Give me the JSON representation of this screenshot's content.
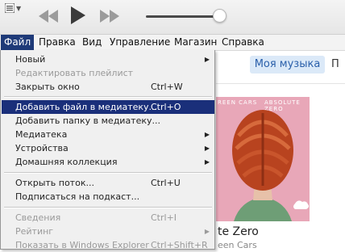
{
  "menubar": {
    "items": [
      {
        "label": "Файл"
      },
      {
        "label": "Правка"
      },
      {
        "label": "Вид"
      },
      {
        "label": "Управление"
      },
      {
        "label": "Магазин"
      },
      {
        "label": "Справка"
      }
    ]
  },
  "content": {
    "tab_active": "Моя музыка",
    "tab_next": "П",
    "album_title": "te Zero",
    "album_artist": "een Cars",
    "album_cover_text_left": "REEN CARS",
    "album_cover_text_right": "ABSOLUTE ZERO"
  },
  "file_menu": {
    "items": [
      {
        "label": "Новый",
        "shortcut": "",
        "submenu": true,
        "disabled": false
      },
      {
        "label": "Редактировать плейлист",
        "shortcut": "",
        "submenu": false,
        "disabled": true
      },
      {
        "label": "Закрыть окно",
        "shortcut": "Ctrl+W",
        "submenu": false,
        "disabled": false
      },
      {
        "label": "Добавить файл в медиатеку...",
        "shortcut": "Ctrl+O",
        "submenu": false,
        "disabled": false,
        "highlighted": true
      },
      {
        "label": "Добавить папку в медиатеку...",
        "shortcut": "",
        "submenu": false,
        "disabled": false
      },
      {
        "label": "Медиатека",
        "shortcut": "",
        "submenu": true,
        "disabled": false
      },
      {
        "label": "Устройства",
        "shortcut": "",
        "submenu": true,
        "disabled": false
      },
      {
        "label": "Домашняя коллекция",
        "shortcut": "",
        "submenu": true,
        "disabled": false
      },
      {
        "label": "Открыть поток...",
        "shortcut": "Ctrl+U",
        "submenu": false,
        "disabled": false
      },
      {
        "label": "Подписаться на подкаст...",
        "shortcut": "",
        "submenu": false,
        "disabled": false
      },
      {
        "label": "Сведения",
        "shortcut": "Ctrl+I",
        "submenu": false,
        "disabled": true
      },
      {
        "label": "Рейтинг",
        "shortcut": "",
        "submenu": true,
        "disabled": true
      },
      {
        "label": "Показать в Windows Explorer",
        "shortcut": "Ctrl+Shift+R",
        "submenu": false,
        "disabled": true
      }
    ]
  },
  "colors": {
    "menu_highlight": "#1a2f7a",
    "menubar_active": "#1e3a78",
    "tab_active_bg": "#dbe9f8",
    "album_bg": "#e8a7b8"
  },
  "player": {
    "volume": 0.9
  }
}
